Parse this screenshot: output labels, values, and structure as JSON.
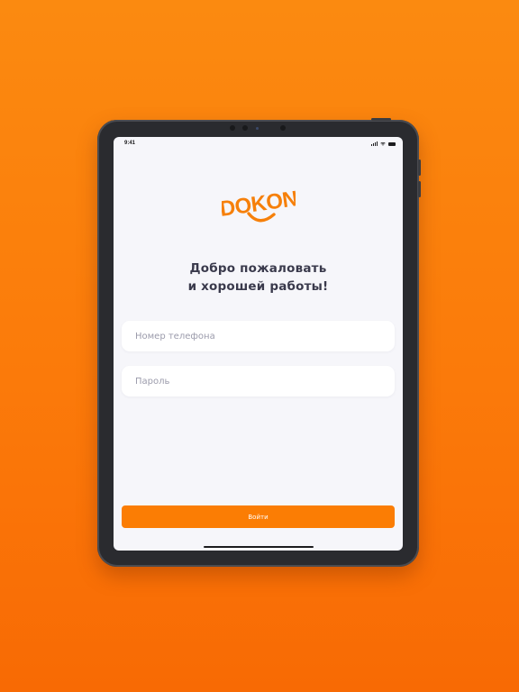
{
  "status_bar": {
    "time": "9:41",
    "icons": [
      "signal-icon",
      "wifi-icon",
      "battery-icon"
    ]
  },
  "logo": {
    "text": "DOKON",
    "icon": "smile-icon",
    "color": "#f6800a"
  },
  "welcome": {
    "line1": "Добро пожаловать",
    "line2": "и хорошей работы!"
  },
  "form": {
    "phone_placeholder": "Номер телефона",
    "password_placeholder": "Пароль",
    "submit_label": "Войти"
  },
  "colors": {
    "background": "#fb7d0a",
    "accent": "#fb7d04",
    "screen": "#f6f6fa",
    "heading": "#3a3a4c"
  }
}
